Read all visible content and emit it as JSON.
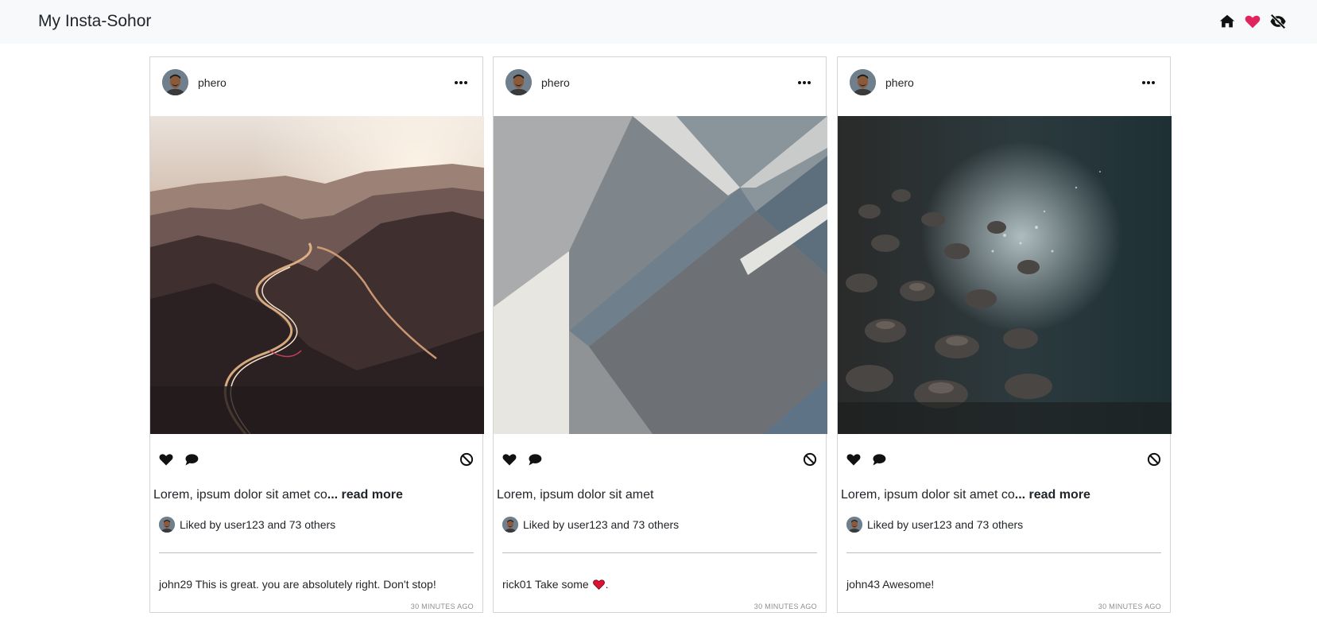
{
  "app": {
    "title": "My Insta-Sohor"
  },
  "nav": {
    "icons": [
      "home-icon",
      "heart-icon",
      "eye-slash-icon"
    ],
    "accent_color": "#e0245e"
  },
  "posts": [
    {
      "username": "phero",
      "image": "winding mountain road at sunset",
      "caption_text": "Lorem, ipsum dolor sit amet co",
      "caption_more": "... read more",
      "likes_text": "Liked by user123 and 73 others",
      "comment_user": "john29",
      "comment_text": "This is great. you are absolutely right. Don't stop!",
      "comment_suffix": "",
      "time": "30 MINUTES AGO"
    },
    {
      "username": "phero",
      "image": "abstract grey geometric shapes",
      "caption_text": "Lorem, ipsum dolor sit amet",
      "caption_more": "",
      "likes_text": "Liked by user123 and 73 others",
      "comment_user": "rick01",
      "comment_text": "Take some",
      "comment_suffix": ".",
      "time": "30 MINUTES AGO"
    },
    {
      "username": "phero",
      "image": "pebbles by dark water",
      "caption_text": "Lorem, ipsum dolor sit amet co",
      "caption_more": "... read more",
      "likes_text": "Liked by user123 and 73 others",
      "comment_user": "john43",
      "comment_text": "Awesome!",
      "comment_suffix": "",
      "time": "30 MINUTES AGO"
    }
  ]
}
